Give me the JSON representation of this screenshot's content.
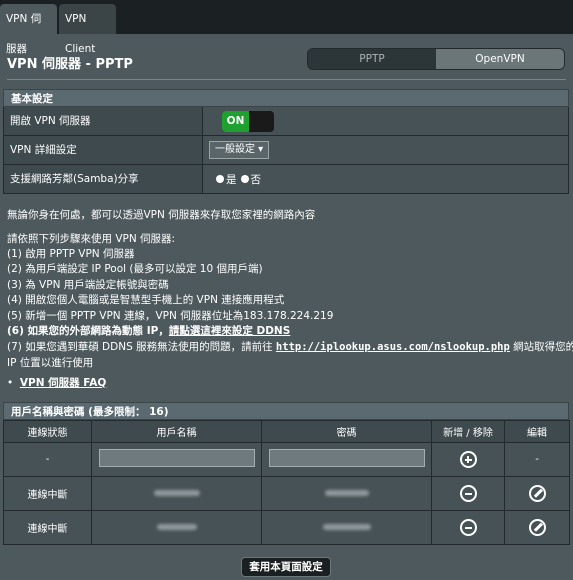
{
  "tabs": [
    "VPN 伺服器",
    "VPN Client"
  ],
  "page_title": "VPN 伺服器 - PPTP",
  "mode_switch": {
    "left": "PPTP",
    "right": "OpenVPN"
  },
  "basic": {
    "header": "基本設定",
    "rows": [
      {
        "label": "開啟 VPN 伺服器",
        "toggle": "ON"
      },
      {
        "label": "VPN 詳細設定",
        "select": "一般設定"
      },
      {
        "label": "支援網路芳鄰(Samba)分享",
        "yes": "是",
        "no": "否"
      }
    ]
  },
  "info": {
    "intro": "無論你身在何處，都可以透過VPN 伺服器來存取您家裡的網路內容",
    "steps_title": "請依照下列步驟來使用 VPN 伺服器:",
    "s1": "(1) 啟用 PPTP VPN 伺服器",
    "s2": "(2) 為用戶端設定 IP Pool (最多可以設定 10 個用戶端)",
    "s3": "(3) 為 VPN 用戶端設定帳號與密碼",
    "s4": "(4) 開啟您個人電腦或是智慧型手機上的 VPN 連接應用程式",
    "s5": "(5) 新增一個 PPTP VPN 連線，VPN 伺服器位址為183.178.224.219",
    "s6_pre": "(6) 如果您的外部網路為動態 IP，",
    "s6_link": "請點選這裡來設定 DDNS",
    "s7_pre": "(7) 如果您遇到華碩 DDNS 服務無法使用的問題，請前往 ",
    "s7_link": "http://iplookup.asus.com/nslookup.php",
    "s7_post": " 網站取得您的寄體",
    "s7_line2": "IP 位置以進行使用",
    "faq": "VPN 伺服器 FAQ"
  },
  "users": {
    "header": "用戶名稱與密碼 (最多限制： 16)",
    "columns": [
      "連線狀態",
      "用戶名稱",
      "密碼",
      "新增 / 移除",
      "編輯"
    ],
    "add_row": {
      "status": "-",
      "edit": "-"
    },
    "rows": [
      {
        "status": "連線中斷"
      },
      {
        "status": "連線中斷"
      }
    ]
  },
  "apply_button": "套用本頁面設定"
}
